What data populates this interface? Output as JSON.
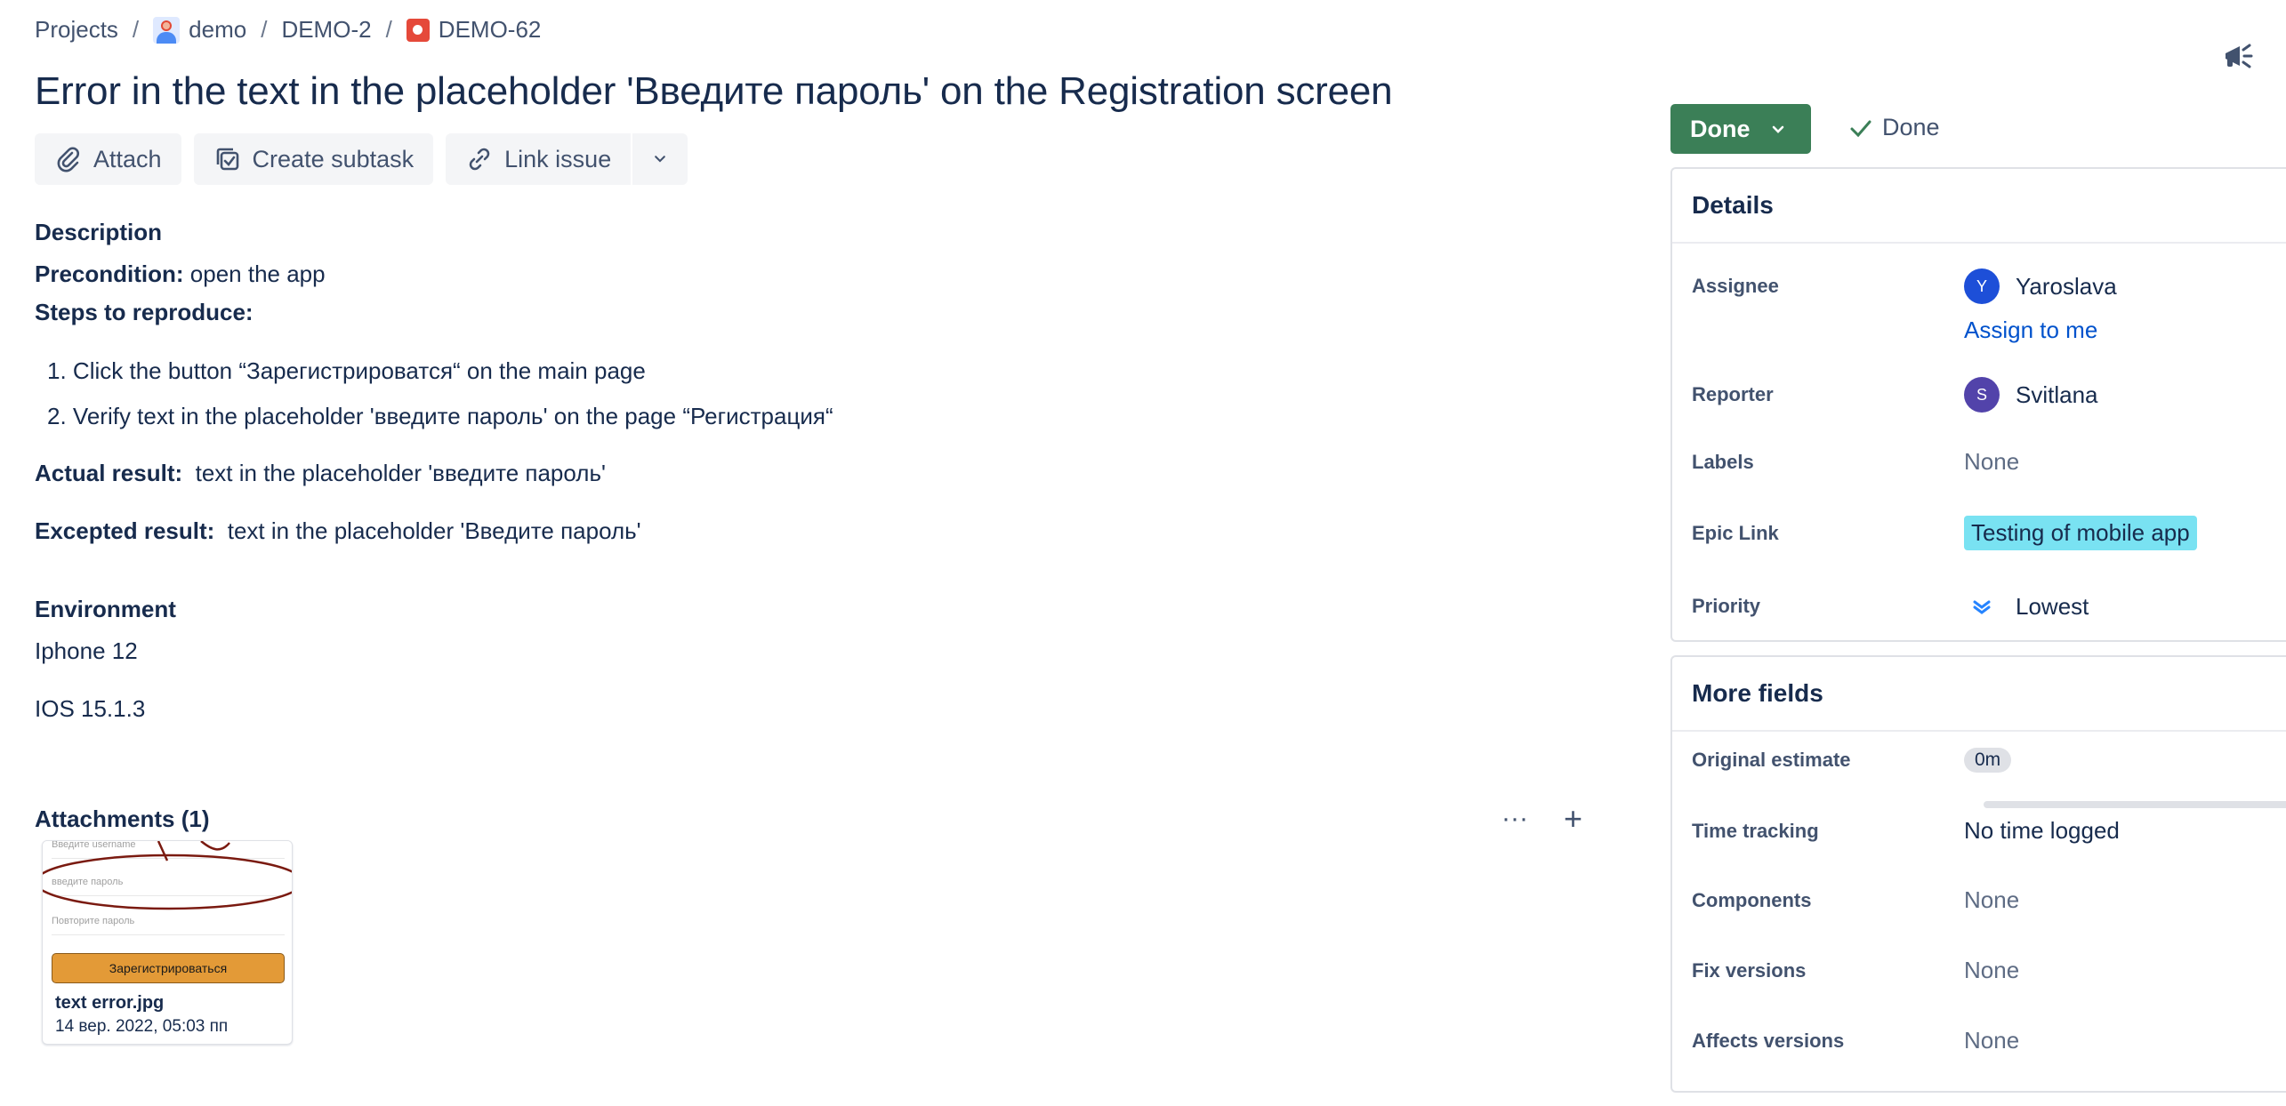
{
  "breadcrumb": {
    "projects": "Projects",
    "project": "demo",
    "epic": "DEMO-2",
    "issue": "DEMO-62",
    "separator": "/"
  },
  "issue": {
    "title": "Error in the text in the placeholder 'Введите пароль' on the Registration screen"
  },
  "toolbar": {
    "attach": "Attach",
    "create_subtask": "Create subtask",
    "link_issue": "Link issue"
  },
  "description": {
    "heading": "Description",
    "precondition_label": "Precondition:",
    "precondition_text": " open the app",
    "steps_label": "Steps to reproduce:",
    "steps": [
      "Click the button “Зарегистрироватся“ on the main page",
      "Verify text in the placeholder 'введите пароль' on the page “Регистрация“"
    ],
    "step_numbers": [
      "1.",
      "2."
    ],
    "actual_label": "Actual result:",
    "actual_text": "  text in the placeholder 'введите пароль'",
    "expected_label": "Excepted result:",
    "expected_text": "  text in the placeholder 'Введите пароль'"
  },
  "environment": {
    "heading": "Environment",
    "device": "Iphone 12",
    "os": "IOS 15.1.3"
  },
  "attachments": {
    "heading": "Attachments (1)",
    "more": "···",
    "add": "+",
    "items": [
      {
        "name": "text error.jpg",
        "date": "14 вер. 2022, 05:03 пп",
        "thumb_fields": [
          "Введите username",
          "введите пароль",
          "Повторите пароль"
        ],
        "thumb_button": "Зарегистрироваться"
      }
    ]
  },
  "status": {
    "button": "Done",
    "resolution": "Done",
    "button_color": "#3b7f57"
  },
  "details": {
    "heading": "Details",
    "assignee_label": "Assignee",
    "assignee_name": "Yaroslava",
    "assignee_initial": "Y",
    "assign_to_me": "Assign to me",
    "reporter_label": "Reporter",
    "reporter_name": "Svitlana",
    "reporter_initial": "S",
    "labels_label": "Labels",
    "labels_value": "None",
    "epic_label": "Epic Link",
    "epic_value": "Testing of mobile app",
    "priority_label": "Priority",
    "priority_value": "Lowest"
  },
  "more_fields": {
    "heading": "More fields",
    "original_estimate_label": "Original estimate",
    "original_estimate_value": "0m",
    "time_tracking_label": "Time tracking",
    "time_tracking_value": "No time logged",
    "components_label": "Components",
    "components_value": "None",
    "fix_versions_label": "Fix versions",
    "fix_versions_value": "None",
    "affects_versions_label": "Affects versions",
    "affects_versions_value": "None"
  },
  "colors": {
    "link": "#0052cc",
    "epic_tag": "#79e2f2",
    "assignee_avatar": "#1d4fd8",
    "reporter_avatar": "#5243aa"
  }
}
